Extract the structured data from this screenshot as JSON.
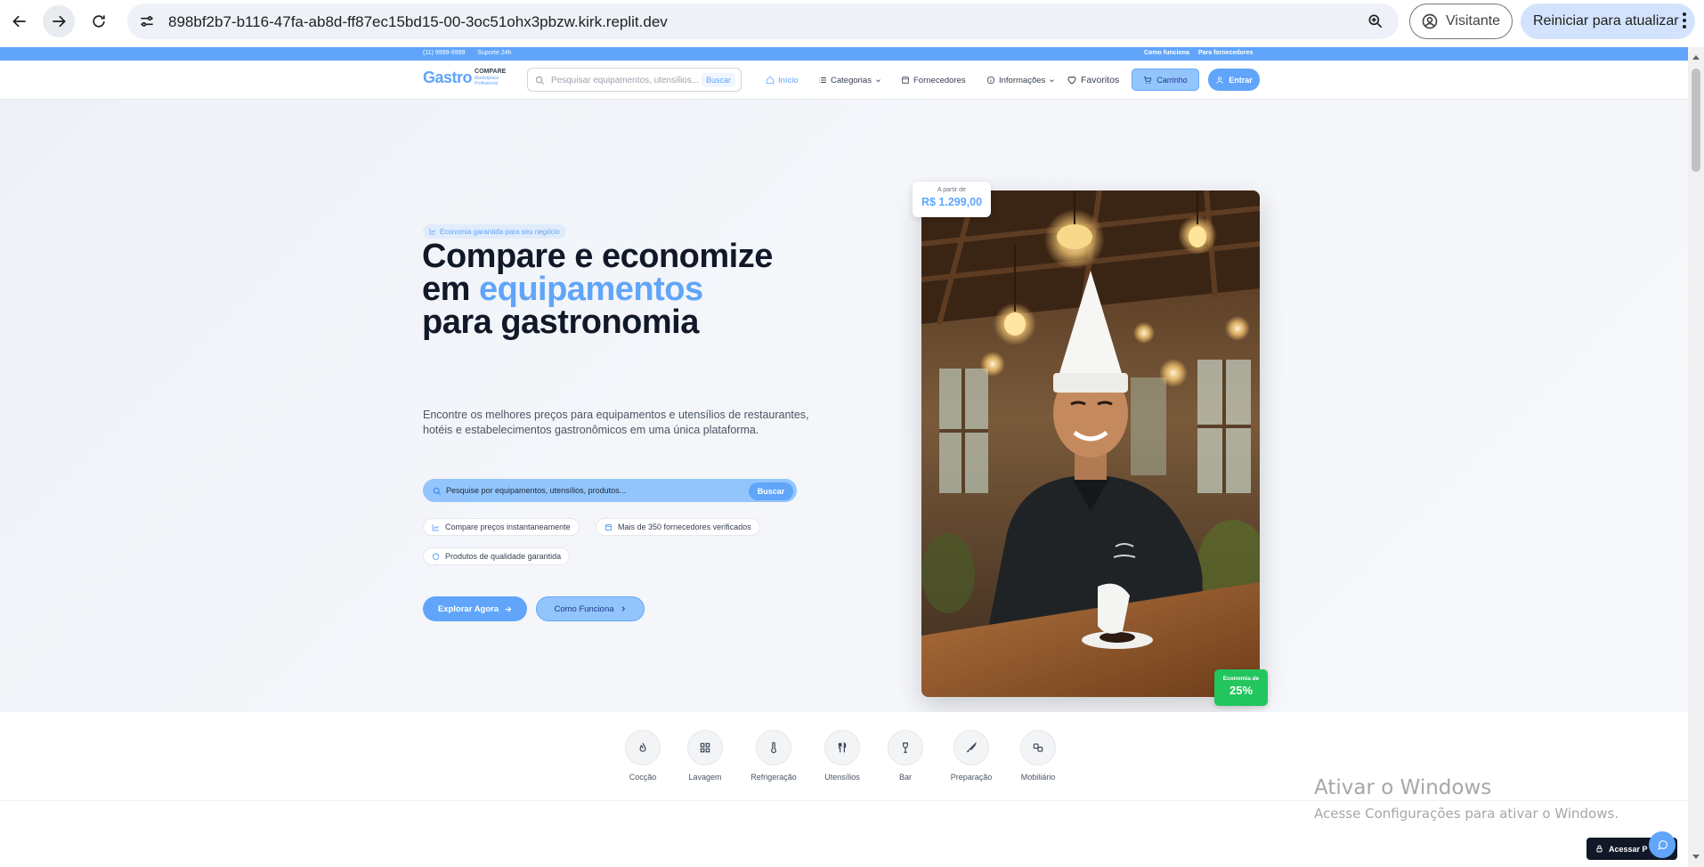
{
  "browser": {
    "url": "898bf2b7-b116-47fa-ab8d-ff87ec15bd15-00-3oc51ohx3pbzw.kirk.replit.dev",
    "profile_label": "Visitante",
    "update_label": "Reiniciar para atualizar"
  },
  "topbar": {
    "phone": "(11) 9999-9999",
    "support": "Suporte 24h",
    "how_it_works": "Como funciona",
    "for_suppliers": "Para fornecedores"
  },
  "header": {
    "logo_main": "Gastro",
    "logo_compare": "COMPARE",
    "logo_sub1": "Marketplace",
    "logo_sub2": "Profissional",
    "search_placeholder": "Pesquisar equipamentos, utensílios...",
    "search_button": "Buscar",
    "nav": {
      "home": "Início",
      "categories": "Categorias",
      "suppliers": "Fornecedores",
      "info": "Informações",
      "favorites": "Favoritos"
    },
    "cart": "Carrinho",
    "login": "Entrar"
  },
  "hero": {
    "badge": "Economia garantida para seu negócio",
    "title_line1": "Compare e economize",
    "title_em": "em",
    "title_accent": "equipamentos",
    "title_line3": "para gastronomia",
    "lead": "Encontre os melhores preços para equipamentos e utensílios de restaurantes, hotéis e estabelecimentos gastronômicos em uma única plataforma.",
    "search_placeholder": "Pesquise por equipamentos, utensílios, produtos...",
    "search_button": "Buscar",
    "features": [
      "Compare preços instantaneamente",
      "Mais de 350 fornecedores verificados",
      "Produtos de qualidade garantida"
    ],
    "cta_primary": "Explorar Agora",
    "cta_secondary": "Como Funciona",
    "price_label": "A partir de",
    "price_value": "R$ 1.299,00",
    "savings_label": "Economia de",
    "savings_value": "25%"
  },
  "categories": [
    {
      "label": "Cocção",
      "icon": "flame-icon"
    },
    {
      "label": "Lavagem",
      "icon": "grid-icon"
    },
    {
      "label": "Refrigeração",
      "icon": "thermometer-icon"
    },
    {
      "label": "Utensílios",
      "icon": "utensils-icon"
    },
    {
      "label": "Bar",
      "icon": "wine-icon"
    },
    {
      "label": "Preparação",
      "icon": "knife-icon"
    },
    {
      "label": "Mobiliário",
      "icon": "chairs-icon"
    }
  ],
  "windows_watermark": {
    "title": "Ativar o Windows",
    "subtitle": "Acesse Configurações para ativar o Windows."
  },
  "floating": {
    "access": "Acessar P"
  },
  "colors": {
    "accent": "#60a5fa",
    "accent_light": "#93c5fd",
    "success": "#22c55e",
    "dark": "#111827"
  }
}
